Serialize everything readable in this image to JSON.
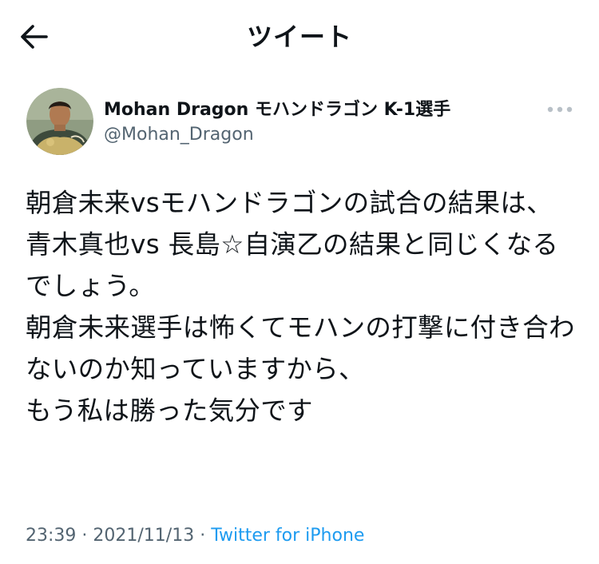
{
  "header": {
    "title": "ツイート",
    "back_icon": "arrow-left-icon"
  },
  "author": {
    "display_name": "Mohan Dragon モハンドラゴン K-1選手",
    "handle": "@Mohan_Dragon",
    "avatar_icon": "profile-photo"
  },
  "tweet": {
    "text": "朝倉未来vsモハンドラゴンの試合の結果は、\n青木真也vs 長島☆自演乙の結果と同じくなるでしょう。\n朝倉未来選手は怖くてモハンの打撃に付き合わないのか知っていますから、\nもう私は勝った気分です",
    "time": "23:39",
    "separator": " · ",
    "date": "2021/11/13",
    "source": "Twitter for iPhone"
  },
  "more_icon": "ellipsis-icon",
  "colors": {
    "text": "#0f1419",
    "secondary": "#536471",
    "link": "#1d9bf0",
    "more": "#b8c0c7"
  }
}
